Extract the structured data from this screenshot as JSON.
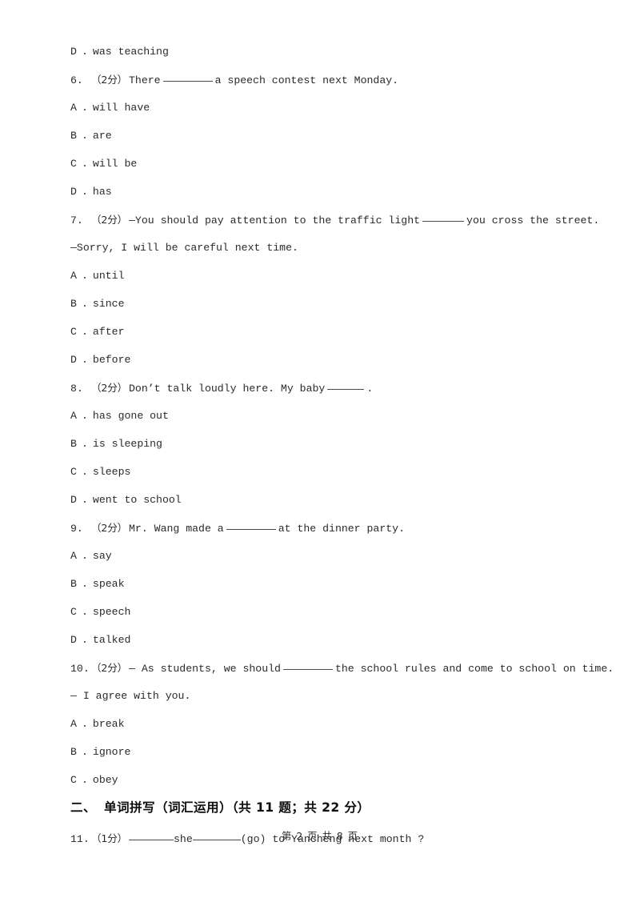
{
  "document": {
    "paper_type": "english-exam-paper",
    "page_footer": "第 2 页 共 8 页"
  },
  "blocks": [
    {
      "kind": "option",
      "letter": "D",
      "sep": ".",
      "text": "was teaching"
    },
    {
      "kind": "question",
      "number": "6.",
      "marks": "（2分）",
      "pre": "There",
      "blank": "lg",
      "post": "a speech contest next Monday."
    },
    {
      "kind": "option",
      "letter": "A",
      "sep": ".",
      "text": "will have"
    },
    {
      "kind": "option",
      "letter": "B",
      "sep": ".",
      "text": "are"
    },
    {
      "kind": "option",
      "letter": "C",
      "sep": ".",
      "text": "will be"
    },
    {
      "kind": "option",
      "letter": "D",
      "sep": ".",
      "text": "has"
    },
    {
      "kind": "question",
      "number": "7.",
      "marks": "（2分）",
      "pre": "—You should pay attention to the traffic light",
      "blank": "md",
      "post": "you cross the street."
    },
    {
      "kind": "continuation",
      "text": "—Sorry, I will be careful next time."
    },
    {
      "kind": "option",
      "letter": "A",
      "sep": ".",
      "text": "until"
    },
    {
      "kind": "option",
      "letter": "B",
      "sep": ".",
      "text": "since"
    },
    {
      "kind": "option",
      "letter": "C",
      "sep": ".",
      "text": "after"
    },
    {
      "kind": "option",
      "letter": "D",
      "sep": ".",
      "text": "before"
    },
    {
      "kind": "question",
      "number": "8.",
      "marks": "（2分）",
      "pre": "Don’t talk loudly here. My baby",
      "blank": "sm",
      "post": "."
    },
    {
      "kind": "option",
      "letter": "A",
      "sep": ".",
      "text": "has gone out"
    },
    {
      "kind": "option",
      "letter": "B",
      "sep": ".",
      "text": "is sleeping"
    },
    {
      "kind": "option",
      "letter": "C",
      "sep": ".",
      "text": "sleeps"
    },
    {
      "kind": "option",
      "letter": "D",
      "sep": ".",
      "text": "went to school"
    },
    {
      "kind": "question",
      "number": "9.",
      "marks": "（2分）",
      "pre": "Mr. Wang made a",
      "blank": "lg",
      "post": "at the dinner party."
    },
    {
      "kind": "option",
      "letter": "A",
      "sep": ".",
      "text": "say"
    },
    {
      "kind": "option",
      "letter": "B",
      "sep": ".",
      "text": "speak"
    },
    {
      "kind": "option",
      "letter": "C",
      "sep": ".",
      "text": "speech"
    },
    {
      "kind": "option",
      "letter": "D",
      "sep": ".",
      "text": "talked"
    },
    {
      "kind": "question",
      "number": "10.",
      "marks": "（2分）",
      "pre": "— As students, we should",
      "blank": "lg",
      "post": "the school rules and come to school on time."
    },
    {
      "kind": "continuation",
      "text": "— I agree with you."
    },
    {
      "kind": "option",
      "letter": "A",
      "sep": ".",
      "text": "break"
    },
    {
      "kind": "option",
      "letter": "B",
      "sep": ".",
      "text": "ignore"
    },
    {
      "kind": "option",
      "letter": "C",
      "sep": ".",
      "text": "obey"
    },
    {
      "kind": "heading",
      "index": "二、",
      "title": "单词拼写（词汇运用）（共 11 题；共 22 分）"
    },
    {
      "kind": "question-fill",
      "number": "11.",
      "marks": "（1分）",
      "blank_a": "q11a",
      "mid": "she",
      "blank_b": "q11b",
      "post": "(go) to Yancheng next month ?"
    }
  ]
}
